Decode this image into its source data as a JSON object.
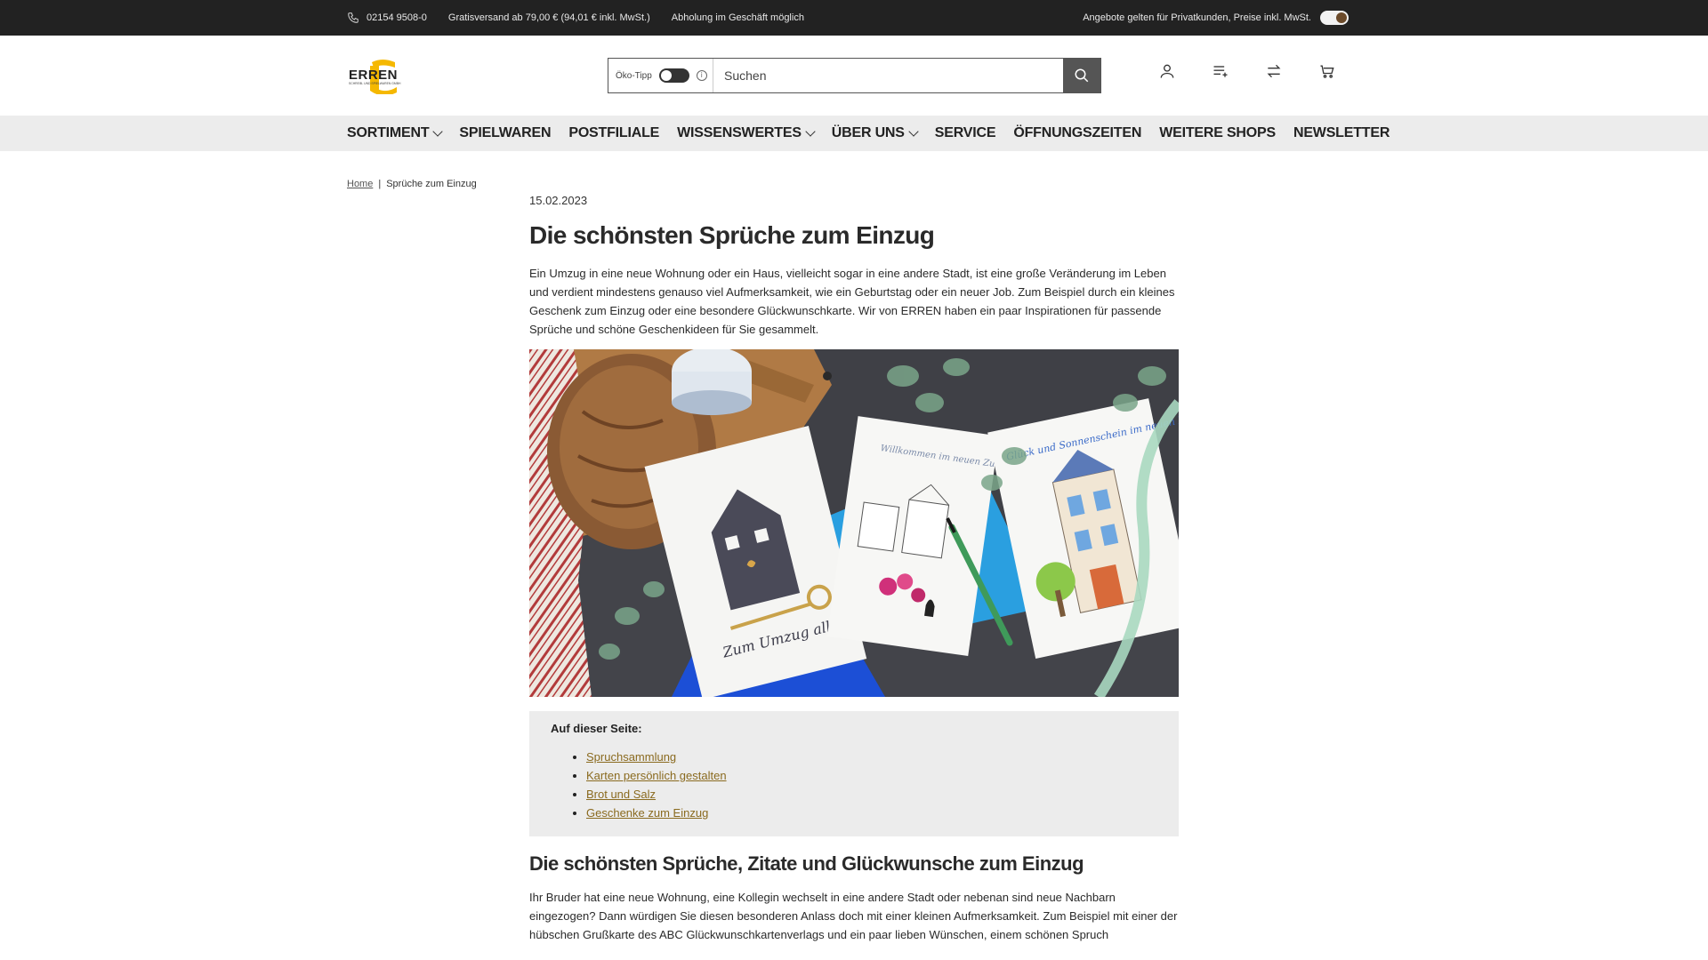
{
  "topbar": {
    "phone": "02154 9508-0",
    "shipping": "Gratisversand ab 79,00 € (94,01 € inkl. MwSt.)",
    "pickup": "Abholung im Geschäft möglich",
    "notice": "Angebote gelten für Privatkunden, Preise inkl. MwSt."
  },
  "header": {
    "logo_text": "ERREN",
    "logo_subtext": "SCHREIB- UND SPIELWAREN GMBH",
    "oeko_label": "Öko-Tipp",
    "search_placeholder": "Suchen"
  },
  "nav": {
    "items": [
      {
        "label": "Sortiment"
      },
      {
        "label": "Spielwaren"
      },
      {
        "label": "Postfiliale"
      },
      {
        "label": "Wissenswertes"
      },
      {
        "label": "Über uns"
      },
      {
        "label": "Service"
      },
      {
        "label": "Öffnungszeiten"
      },
      {
        "label": "Weitere Shops"
      },
      {
        "label": "Newsletter"
      }
    ]
  },
  "breadcrumb": {
    "home": "Home",
    "separator": "|",
    "current": "Sprüche zum Einzug"
  },
  "article": {
    "date": "15.02.2023",
    "title": "Die schönsten Sprüche zum Einzug",
    "intro": "Ein Umzug in eine neue Wohnung oder ein Haus, vielleicht sogar in eine andere Stadt, ist eine große Veränderung im Leben und verdient mindestens genauso viel Aufmerksamkeit, wie ein Geburtstag oder ein neuer Job. Zum Beispiel durch ein kleines Geschenk zum Einzug oder eine besondere Glückwunschkarte. Wir von ERREN haben ein paar Inspirationen für passende Sprüche und schöne Geschenkideen für Sie gesammelt.",
    "toc_title": "Auf dieser Seite:",
    "toc_items": [
      {
        "label": "Spruchsammlung"
      },
      {
        "label": "Karten persönlich gestalten"
      },
      {
        "label": "Brot und Salz"
      },
      {
        "label": "Geschenke zum Einzug"
      }
    ],
    "section_title": "Die schönsten Sprüche, Zitate und Glückwunsche zum Einzug",
    "section_text": "Ihr Bruder hat eine neue Wohnung, eine Kollegin wechselt in eine andere Stadt oder nebenan sind neue Nachbarn eingezogen? Dann würdigen Sie diesen besonderen Anlass doch mit einer kleinen Aufmerksamkeit. Zum Beispiel mit einer der hübschen Grußkarte des ABC Glückwunschkartenverlags und ein paar lieben Wünschen, einem schönen Spruch"
  },
  "hero_image": {
    "card1_text": "Zum Umzug alles Gute",
    "card2_text": "Willkommen im neuen Zuhause",
    "card3_text": "Glück und Sonnenschein im neuen Heim"
  },
  "colors": {
    "topbar_bg": "#222222",
    "nav_bg": "#ececec",
    "logo_yellow": "#f5b800",
    "link_color": "#8a6a1f",
    "toc_bg": "#ececec"
  }
}
